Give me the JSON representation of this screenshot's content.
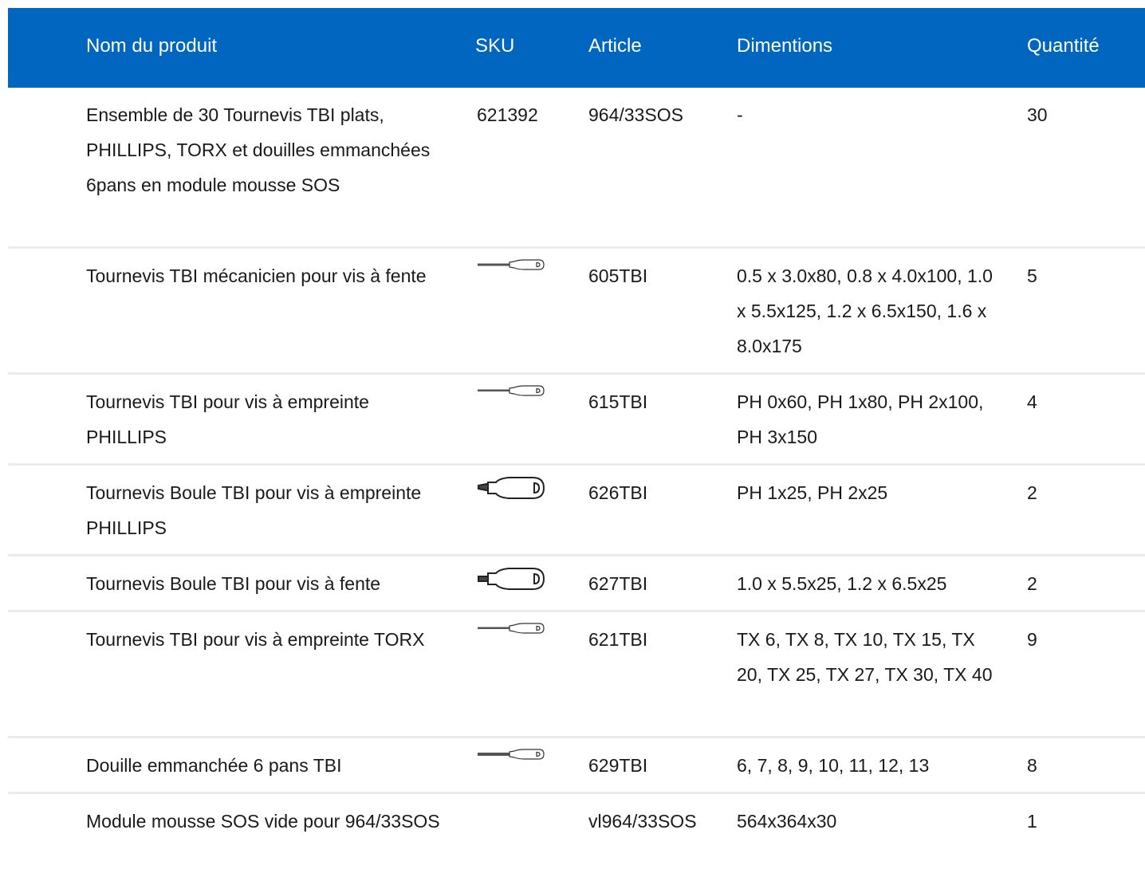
{
  "header": {
    "name": "Nom du produit",
    "sku": "SKU",
    "article": "Article",
    "dimensions": "Dimentions",
    "quantity": "Quantité"
  },
  "rows": [
    {
      "name": "Ensemble de 30 Tournevis TBI plats, PHILLIPS, TORX et douilles emmanchées 6pans en module mousse SOS",
      "sku": "621392",
      "article": "964/33SOS",
      "dimensions": "-",
      "quantity": "30"
    },
    {
      "name": "Tournevis TBI mécanicien pour vis à fente",
      "sku_icon": "slim-screwdriver-icon",
      "article": "605TBI",
      "dimensions": "0.5 x 3.0x80, 0.8 x 4.0x100, 1.0 x 5.5x125, 1.2 x 6.5x150, 1.6 x 8.0x175",
      "quantity": "5"
    },
    {
      "name": "Tournevis TBI pour vis à empreinte PHILLIPS",
      "sku_icon": "slim-screwdriver-icon",
      "article": "615TBI",
      "dimensions": "PH 0x60, PH 1x80, PH 2x100, PH 3x150",
      "quantity": "4"
    },
    {
      "name": "Tournevis Boule TBI pour vis à empreinte PHILLIPS",
      "sku_icon": "stubby-screwdriver-icon",
      "article": "626TBI",
      "dimensions": "PH 1x25, PH 2x25",
      "quantity": "2"
    },
    {
      "name": "Tournevis Boule TBI pour vis à fente",
      "sku_icon": "stubby-screwdriver-icon",
      "article": "627TBI",
      "dimensions": "1.0 x 5.5x25, 1.2 x 6.5x25",
      "quantity": "2"
    },
    {
      "name": "Tournevis TBI pour vis à empreinte TORX",
      "sku_icon": "slim-screwdriver-icon",
      "article": "621TBI",
      "dimensions": "TX 6, TX 8, TX 10, TX 15, TX 20, TX 25, TX 27, TX 30, TX 40",
      "quantity": "9"
    },
    {
      "name": "Douille emmanchée 6 pans TBI",
      "sku_icon": "slim-screwdriver-icon",
      "article": "629TBI",
      "dimensions": "6, 7, 8, 9, 10, 11, 12, 13",
      "quantity": "8"
    },
    {
      "name": "Module mousse SOS vide pour 964/33SOS",
      "sku": "",
      "article": "vl964/33SOS",
      "dimensions": "564x364x30",
      "quantity": "1"
    }
  ]
}
